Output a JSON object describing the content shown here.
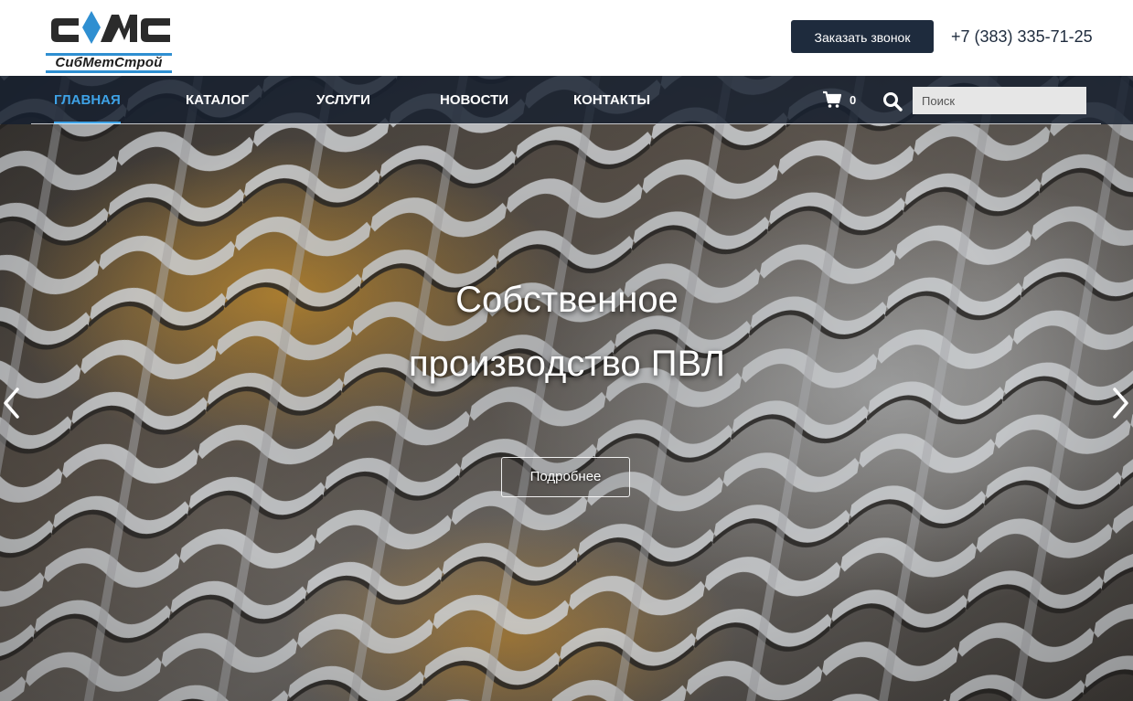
{
  "header": {
    "logo_text": "СибМетСтрой",
    "callback_label": "Заказать звонок",
    "phone": "+7 (383) 335-71-25"
  },
  "nav": {
    "items": [
      {
        "label": "Главная",
        "active": true
      },
      {
        "label": "Каталог",
        "active": false
      },
      {
        "label": "Услуги",
        "active": false
      },
      {
        "label": "Новости",
        "active": false
      },
      {
        "label": "Контакты",
        "active": false
      }
    ],
    "cart_count": "0",
    "search_placeholder": "Поиск"
  },
  "slide": {
    "title_line1": "Собственное",
    "title_line2": "производство ПВЛ",
    "button_label": "Подробнее"
  },
  "colors": {
    "dark_navy": "#1e2b3d",
    "accent_blue": "#3ea2e6",
    "logo_blue": "#2f8fd1"
  },
  "icons": {
    "cart": "cart-icon",
    "search": "search-icon",
    "prev": "chevron-left-icon",
    "next": "chevron-right-icon"
  }
}
